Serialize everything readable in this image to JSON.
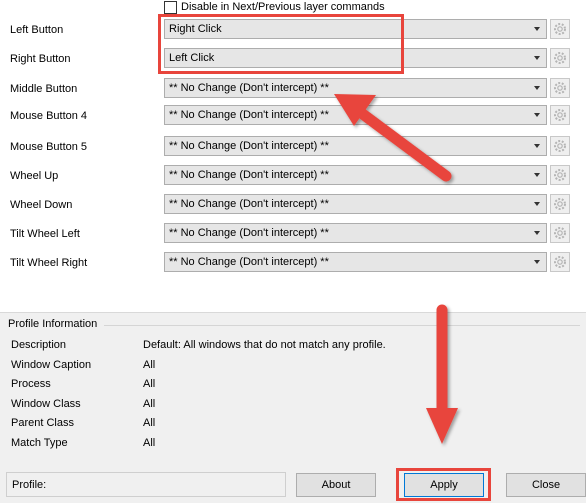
{
  "checkbox": {
    "label": "Disable in Next/Previous layer commands",
    "checked": false
  },
  "rows": [
    {
      "label": "Left Button",
      "value": "Right Click"
    },
    {
      "label": "Right Button",
      "value": "Left Click"
    },
    {
      "label": "Middle Button",
      "value": "** No Change (Don't intercept) **"
    },
    {
      "label": "Mouse Button 4",
      "value": "** No Change (Don't intercept) **"
    },
    {
      "label": "Mouse Button 5",
      "value": "** No Change (Don't intercept) **"
    },
    {
      "label": "Wheel Up",
      "value": "** No Change (Don't intercept) **"
    },
    {
      "label": "Wheel Down",
      "value": "** No Change (Don't intercept) **"
    },
    {
      "label": "Tilt Wheel Left",
      "value": "** No Change (Don't intercept) **"
    },
    {
      "label": "Tilt Wheel Right",
      "value": "** No Change (Don't intercept) **"
    }
  ],
  "profile_info": {
    "title": "Profile Information",
    "items": [
      {
        "label": "Description",
        "value": "Default: All windows that do not match any profile."
      },
      {
        "label": "Window Caption",
        "value": "All"
      },
      {
        "label": "Process",
        "value": "All"
      },
      {
        "label": "Window Class",
        "value": "All"
      },
      {
        "label": "Parent Class",
        "value": "All"
      },
      {
        "label": "Match Type",
        "value": "All"
      }
    ]
  },
  "bottom": {
    "profile_label": "Profile:",
    "about": "About",
    "apply": "Apply",
    "close": "Close"
  },
  "annotation_color": "#e8453c"
}
